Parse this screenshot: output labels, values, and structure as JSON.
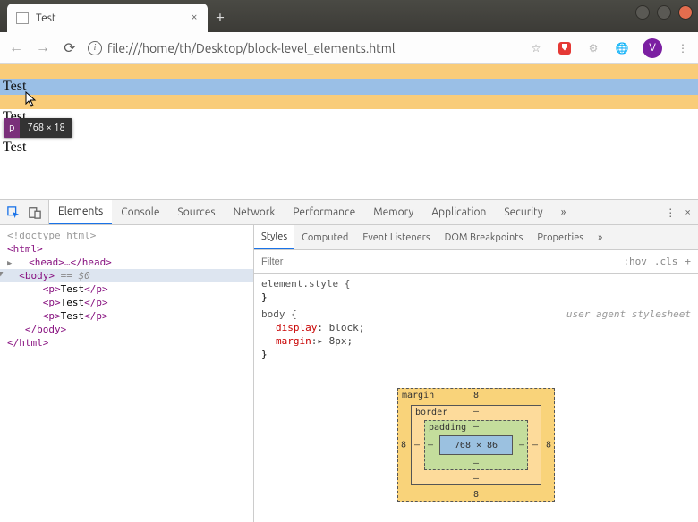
{
  "window": {
    "tab_title": "Test",
    "new_tab": "+"
  },
  "toolbar": {
    "url": "file:///home/th/Desktop/block-level_elements.html",
    "avatar_letter": "V"
  },
  "page": {
    "p_texts": [
      "Test",
      "Test",
      "Test"
    ],
    "tooltip_tag": "p",
    "tooltip_dims": "768 × 18"
  },
  "devtools": {
    "tabs": [
      "Elements",
      "Console",
      "Sources",
      "Network",
      "Performance",
      "Memory",
      "Application",
      "Security"
    ],
    "active_tab": "Elements",
    "more": "»",
    "dom": {
      "doctype": "<!doctype html>",
      "html_open": "<html>",
      "head": "<head>…</head>",
      "body_open": "<body>",
      "body_eq": " == $0",
      "p_open": "<p>",
      "p_text": "Test",
      "p_close": "</p>",
      "body_close": "</body>",
      "html_close": "</html>"
    },
    "styles": {
      "tabs": [
        "Styles",
        "Computed",
        "Event Listeners",
        "DOM Breakpoints",
        "Properties"
      ],
      "active_tab": "Styles",
      "filter_placeholder": "Filter",
      "hov": ":hov",
      "cls": ".cls",
      "plus": "+",
      "element_style": "element.style {",
      "close_brace": "}",
      "body_rule": "body {",
      "uas": "user agent stylesheet",
      "display_prop": "display",
      "display_val": ": block;",
      "margin_prop": "margin",
      "margin_val": ":▸ 8px;"
    },
    "boxmodel": {
      "margin_label": "margin",
      "border_label": "border",
      "padding_label": "padding",
      "content": "768 × 86",
      "margin_vals": {
        "top": "8",
        "right": "8",
        "bottom": "8",
        "left": "8"
      },
      "border_vals": "–",
      "padding_vals": "–"
    }
  }
}
